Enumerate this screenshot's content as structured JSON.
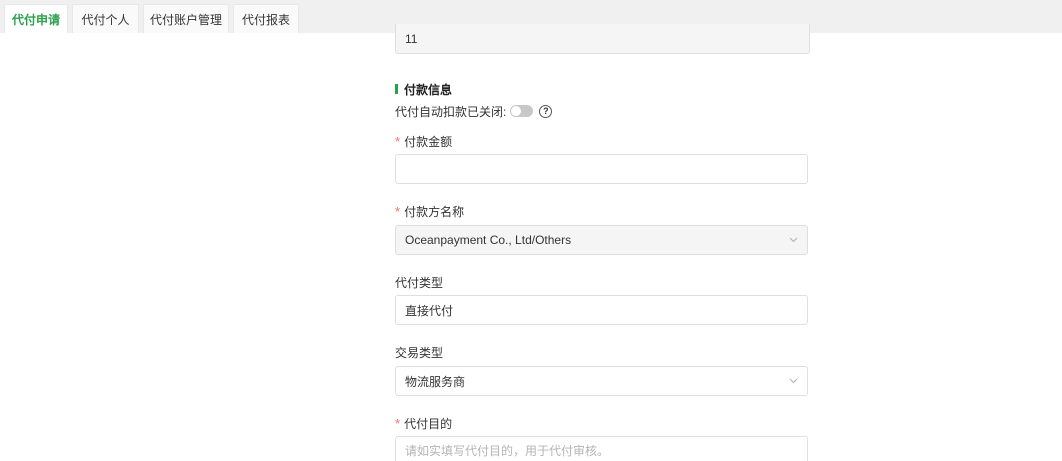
{
  "tabs": [
    {
      "label": "代付申请",
      "active": true
    },
    {
      "label": "代付个人",
      "active": false
    },
    {
      "label": "代付账户管理",
      "active": false
    },
    {
      "label": "代付报表",
      "active": false
    }
  ],
  "top_field": {
    "value": "11"
  },
  "payment_section": {
    "title": "付款信息",
    "auto_deduct_label": "代付自动扣款已关闭:",
    "auto_deduct_on": false
  },
  "fields": {
    "amount": {
      "label": "付款金额",
      "required": true,
      "value": ""
    },
    "payer_name": {
      "label": "付款方名称",
      "required": true,
      "value": "Oceanpayment Co., Ltd/Others"
    },
    "payout_type": {
      "label": "代付类型",
      "required": false,
      "value": "直接代付"
    },
    "trade_type": {
      "label": "交易类型",
      "required": false,
      "value": "物流服务商"
    },
    "purpose": {
      "label": "代付目的",
      "required": true,
      "placeholder": "请如实填写代付目的，用于代付审核。"
    }
  },
  "colors": {
    "accent": "#2aa14b",
    "required": "#f56c6c",
    "border": "#dcdfe6"
  },
  "icons": {
    "help": "question-circle-icon",
    "select": "chevron-down-icon"
  }
}
